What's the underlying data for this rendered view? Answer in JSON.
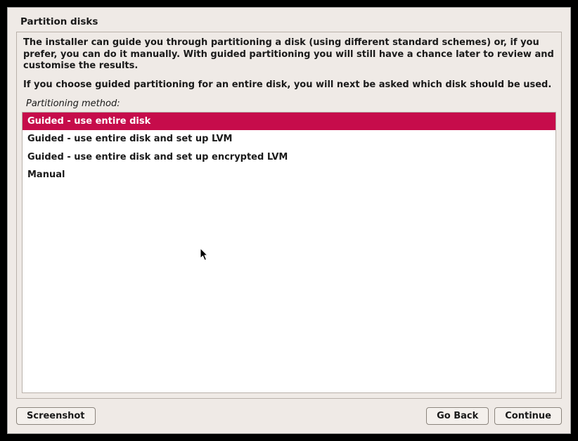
{
  "title": "Partition disks",
  "intro_paragraph1": "The installer can guide you through partitioning a disk (using different standard schemes) or, if you prefer, you can do it manually. With guided partitioning you will still have a chance later to review and customise the results.",
  "intro_paragraph2": "If you choose guided partitioning for an entire disk, you will next be asked which disk should be used.",
  "method_label": "Partitioning method:",
  "options": [
    {
      "label": "Guided - use entire disk",
      "selected": true
    },
    {
      "label": "Guided - use entire disk and set up LVM",
      "selected": false
    },
    {
      "label": "Guided - use entire disk and set up encrypted LVM",
      "selected": false
    },
    {
      "label": "Manual",
      "selected": false
    }
  ],
  "buttons": {
    "screenshot": "Screenshot",
    "go_back": "Go Back",
    "continue": "Continue"
  }
}
